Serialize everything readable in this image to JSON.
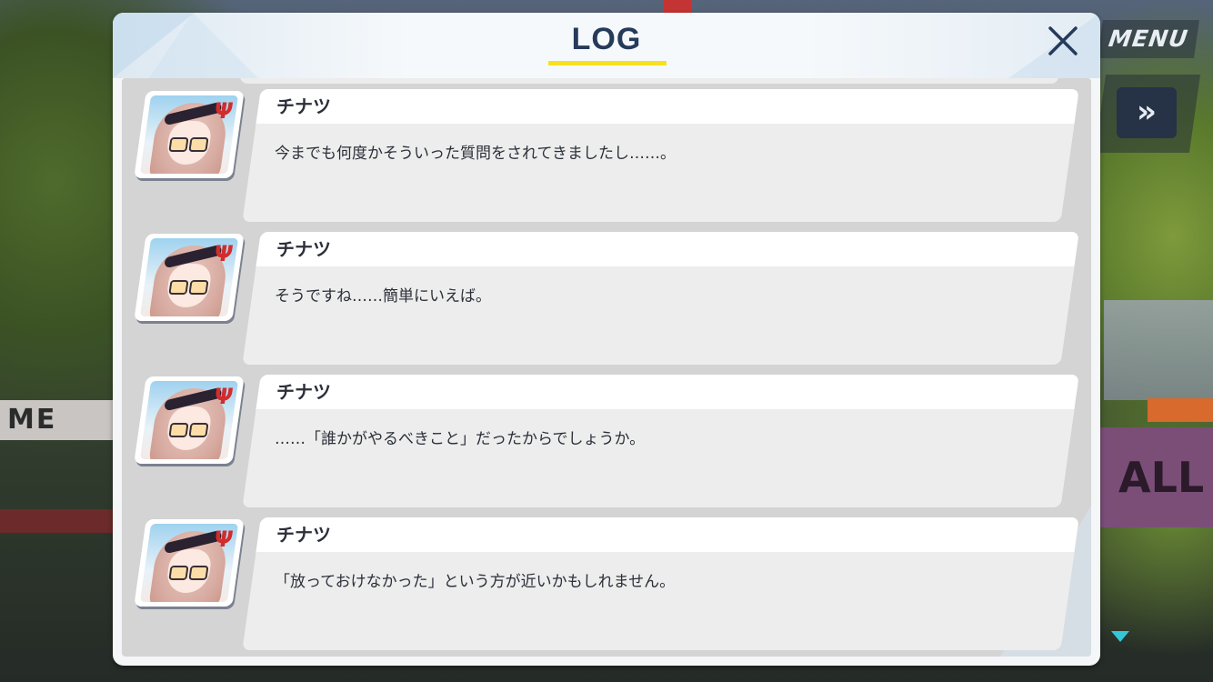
{
  "header": {
    "title": "LOG",
    "close_icon": "close-icon"
  },
  "hud": {
    "menu_label": "MENU",
    "fast_forward_label": "»"
  },
  "background": {
    "sign_left": "ME",
    "sign_right": "ALL"
  },
  "entries": [
    {
      "speaker": "チナツ",
      "text": "今までも何度かそういった質問をされてきましたし……。",
      "avatar": "chinatsu-portrait"
    },
    {
      "speaker": "チナツ",
      "text": "そうですね……簡単にいえば。",
      "avatar": "chinatsu-portrait"
    },
    {
      "speaker": "チナツ",
      "text": "……「誰かがやるべきこと」だったからでしょうか。",
      "avatar": "chinatsu-portrait"
    },
    {
      "speaker": "チナツ",
      "text": "「放っておけなかった」という方が近いかもしれません。",
      "avatar": "chinatsu-portrait"
    }
  ],
  "colors": {
    "title": "#263a5a",
    "underline": "#f6e020",
    "scroll_indicator": "#33c7d8",
    "halo": "#d22c2c"
  }
}
